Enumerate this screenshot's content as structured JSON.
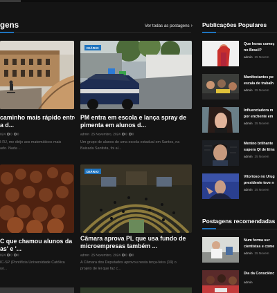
{
  "main": {
    "section_title": "gens",
    "see_all": "Ver todas as postagens",
    "cards": [
      {
        "badge": "",
        "title_l1": "caminho mais rápido entre",
        "title_l2": "a d...",
        "meta_date": "024",
        "meta_views": "0",
        "meta_comments": "0",
        "excerpt_l1": "I-RJ, me dirijo aos matemáticos mais",
        "excerpt_l2": "ado. Nada ..."
      },
      {
        "badge": "DIÁRIO",
        "title_l1": "PM entra em escola e lança spray de",
        "title_l2": "pimenta em alunos d...",
        "meta_author": "admin",
        "meta_date": "25 Novembro, 2024",
        "meta_views": "0",
        "meta_comments": "0",
        "excerpt_l1": "Um grupo de alunos de uma escola estadual em Santos, na",
        "excerpt_l2": "Baixada Santista, foi al..."
      },
      {
        "badge": "",
        "title_l1": "C que chamou alunos da",
        "title_l2": "as' e '...",
        "meta_date": "024",
        "meta_views": "0",
        "meta_comments": "0",
        "excerpt_l1": "IC-SP (Pontifícia Universidade Católica",
        "excerpt_l2": "uo..."
      },
      {
        "badge": "DIÁRIO",
        "title_l1": "Câmara aprova PL que usa fundo de",
        "title_l2": "microempresas também ...",
        "meta_author": "admin",
        "meta_date": "25 Novembro, 2024",
        "meta_views": "0",
        "meta_comments": "0",
        "excerpt_l1": "A Câmara dos Deputados aprovou nesta terça-feira (19) o",
        "excerpt_l2": "projeto de lei que faz c..."
      }
    ]
  },
  "sidebar": {
    "popular_title": "Publicações Populares",
    "popular": [
      {
        "title_l1": "Que horas começ",
        "title_l2": "no Brasil?",
        "author": "admin",
        "date": "25 Novem"
      },
      {
        "title_l1": "Manifestantes pe",
        "title_l2": "escala de trabalh",
        "author": "admin",
        "date": "25 Novem"
      },
      {
        "title_l1": "Influenciadora m",
        "title_l2": "por enchente em",
        "author": "admin",
        "date": "25 Novem"
      },
      {
        "title_l1": "Menino brilhante",
        "title_l2": "supera QI de Eins",
        "author": "admin",
        "date": "25 Novem"
      },
      {
        "title_l1": "Vitorioso no Urug",
        "title_l2": "presidente teve n",
        "author": "admin",
        "date": "25 Novem"
      }
    ],
    "recommended_title": "Postagens recomendadas",
    "recommended": [
      {
        "title_l1": "Num forma sur",
        "title_l2": "cientistas e come",
        "author": "admin",
        "date": "25 Novem"
      },
      {
        "title_l1": "Dia da Consciênc",
        "title_l2": "",
        "author": "admin",
        "date": ""
      }
    ]
  }
}
